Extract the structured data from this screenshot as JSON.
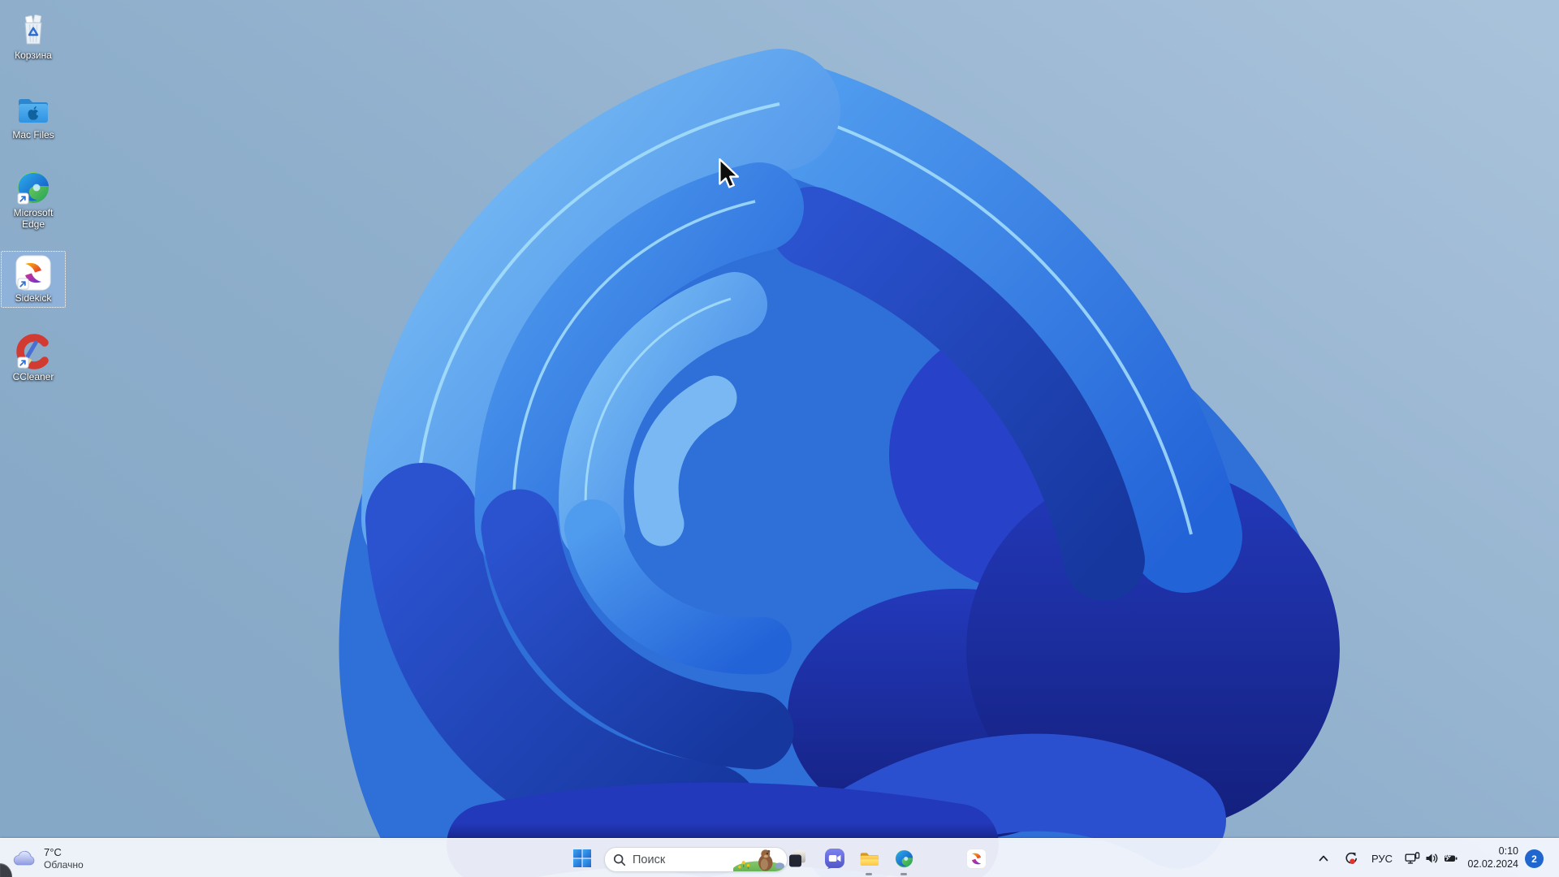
{
  "desktop": {
    "icons": [
      {
        "id": "recycle-bin",
        "label": "Корзина",
        "selected": false
      },
      {
        "id": "mac-files",
        "label": "Mac Files",
        "selected": false
      },
      {
        "id": "microsoft-edge",
        "label": "Microsoft Edge",
        "selected": false
      },
      {
        "id": "sidekick",
        "label": "Sidekick",
        "selected": true
      },
      {
        "id": "ccleaner",
        "label": "CCleaner",
        "selected": false
      }
    ],
    "selected_icon": "Sidekick"
  },
  "taskbar": {
    "weather": {
      "temperature": "7°C",
      "condition": "Облачно"
    },
    "search": {
      "placeholder": "Поиск"
    },
    "tray": {
      "language": "РУС",
      "time": "0:10",
      "date": "02.02.2024",
      "notification_count": "2"
    }
  },
  "icons": {
    "widgets-weather": "cloud-icon",
    "start": "windows-logo-icon",
    "search": "magnifier-icon",
    "search_highlight": "groundhog-day-illustration",
    "pinned_apps": [
      "task-view-icon",
      "chat-icon",
      "file-explorer-icon",
      "edge-icon",
      "sidekick-icon"
    ],
    "tray": [
      "chevron-up-icon",
      "sync-record-icon",
      "network-icon",
      "volume-icon",
      "battery-icon",
      "notification-badge"
    ]
  },
  "colors": {
    "taskbar_bg": "#f2f6fc",
    "badge_blue": "#1f66cf",
    "wallpaper_bg_left": "#7fa3c3",
    "wallpaper_bg_right": "#a9c2db",
    "bloom_main": "#2e6fd8",
    "bloom_light": "#7cc0f5",
    "bloom_deep": "#16379e",
    "selection_highlight": "rgba(150,190,245,0.38)"
  }
}
